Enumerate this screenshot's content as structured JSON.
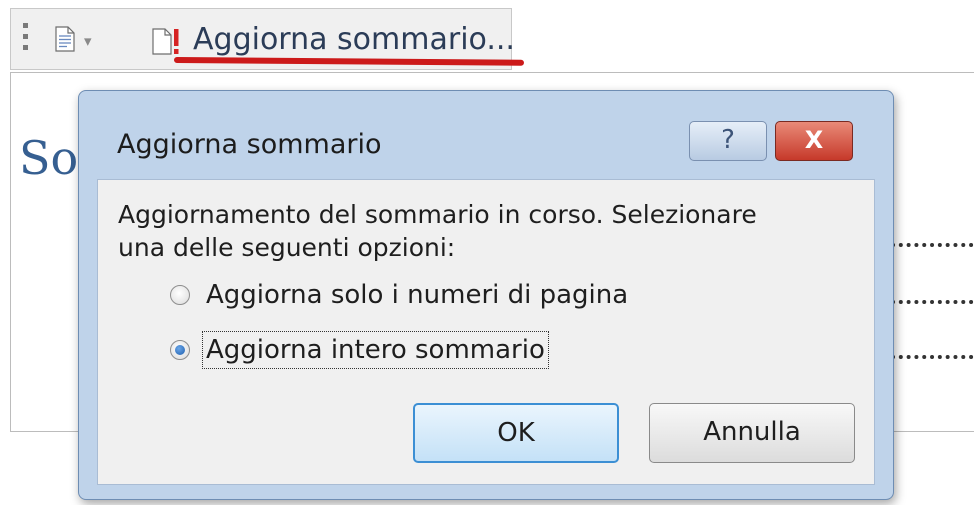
{
  "toolbar": {
    "update_toc_label": "Aggiorna sommario...",
    "highlight_color": "#cc1a1a"
  },
  "document": {
    "heading_visible": "So"
  },
  "dialog": {
    "title": "Aggiorna sommario",
    "help_glyph": "?",
    "close_glyph": "X",
    "message_line1": "Aggiornamento del sommario in corso. Selezionare",
    "message_line2": "una delle seguenti opzioni:",
    "options": [
      {
        "label": "Aggiorna solo i numeri di pagina",
        "checked": false
      },
      {
        "label": "Aggiorna intero sommario",
        "checked": true
      }
    ],
    "ok_label": "OK",
    "cancel_label": "Annulla"
  },
  "icons": {
    "grip": "grip-icon",
    "document": "document-icon",
    "dropdown": "chevron-down-icon",
    "update": "update-toc-icon"
  }
}
